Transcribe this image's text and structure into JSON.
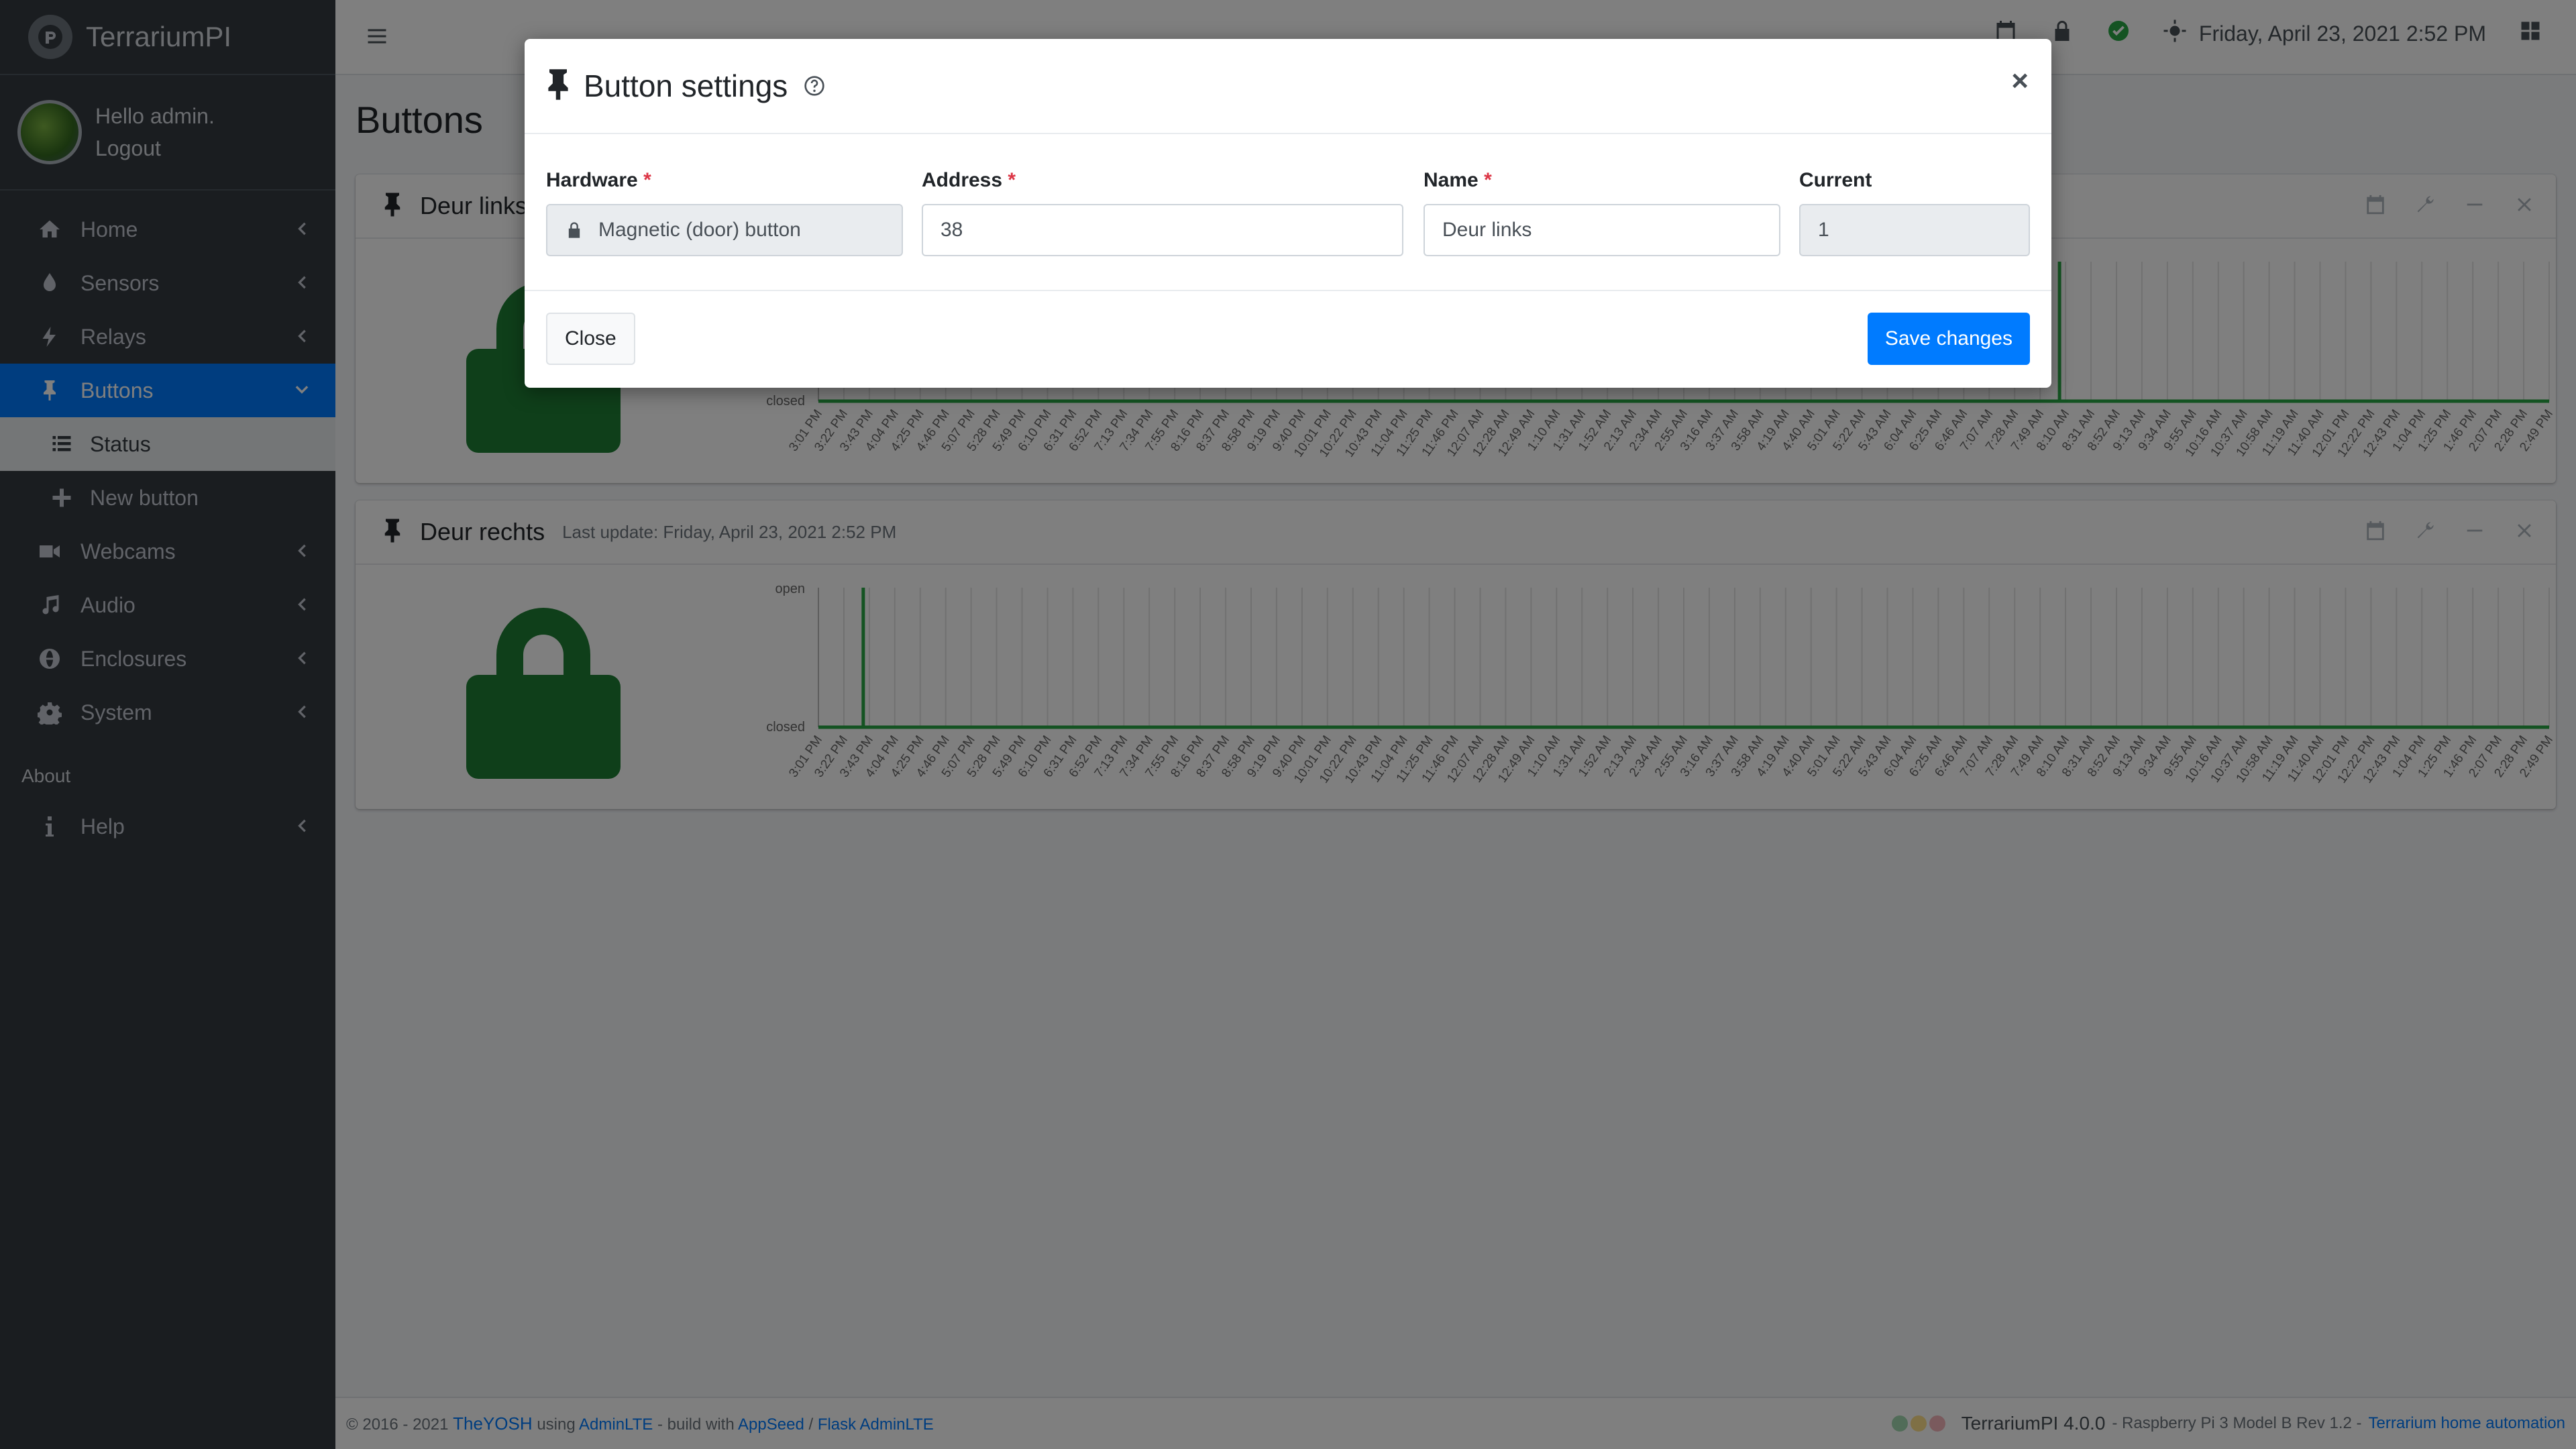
{
  "brand": {
    "name": "TerrariumPI"
  },
  "user": {
    "greeting": "Hello admin.",
    "logout": "Logout"
  },
  "sidebar": {
    "items": [
      {
        "label": "Home",
        "icon": "home-icon"
      },
      {
        "label": "Sensors",
        "icon": "tint-icon"
      },
      {
        "label": "Relays",
        "icon": "bolt-icon"
      },
      {
        "label": "Buttons",
        "icon": "thumbtack-icon"
      },
      {
        "label": "Webcams",
        "icon": "video-icon"
      },
      {
        "label": "Audio",
        "icon": "music-icon"
      },
      {
        "label": "Enclosures",
        "icon": "globe-icon"
      },
      {
        "label": "System",
        "icon": "gear-icon"
      },
      {
        "label": "Help",
        "icon": "info-icon"
      }
    ],
    "subitems": [
      {
        "label": "Status",
        "icon": "list-icon"
      },
      {
        "label": "New button",
        "icon": "plus-icon"
      }
    ],
    "about_header": "About"
  },
  "topbar": {
    "datetime": "Friday, April 23, 2021 2:52 PM"
  },
  "page": {
    "title": "Buttons"
  },
  "cards": [
    {
      "title": "Deur links",
      "subtitle": ""
    },
    {
      "title": "Deur rechts",
      "subtitle": "Last update: Friday, April 23, 2021 2:52 PM"
    }
  ],
  "chart_data": [
    {
      "type": "line",
      "title": "Deur links",
      "y_tick_labels": [
        "open",
        "closed"
      ],
      "x": [
        "3:01 PM",
        "3:22 PM",
        "3:43 PM",
        "4:04 PM",
        "4:25 PM",
        "4:46 PM",
        "5:07 PM",
        "5:28 PM",
        "5:49 PM",
        "6:10 PM",
        "6:31 PM",
        "6:52 PM",
        "7:13 PM",
        "7:34 PM",
        "7:55 PM",
        "8:16 PM",
        "8:37 PM",
        "8:58 PM",
        "9:19 PM",
        "9:40 PM",
        "10:01 PM",
        "10:22 PM",
        "10:43 PM",
        "11:04 PM",
        "11:25 PM",
        "11:46 PM",
        "12:07 AM",
        "12:28 AM",
        "12:49 AM",
        "1:10 AM",
        "1:31 AM",
        "1:52 AM",
        "2:13 AM",
        "2:34 AM",
        "2:55 AM",
        "3:16 AM",
        "3:37 AM",
        "3:58 AM",
        "4:19 AM",
        "4:40 AM",
        "5:01 AM",
        "5:22 AM",
        "5:43 AM",
        "6:04 AM",
        "6:25 AM",
        "6:46 AM",
        "7:07 AM",
        "7:28 AM",
        "7:49 AM",
        "8:10 AM",
        "8:31 AM",
        "8:52 AM",
        "9:13 AM",
        "9:34 AM",
        "9:55 AM",
        "10:16 AM",
        "10:37 AM",
        "10:58 AM",
        "11:19 AM",
        "11:40 AM",
        "12:01 PM",
        "12:22 PM",
        "12:43 PM",
        "1:04 PM",
        "1:25 PM",
        "1:46 PM",
        "2:07 PM",
        "2:28 PM",
        "2:49 PM"
      ],
      "events": [
        {
          "at": "8:05 AM",
          "state": "open"
        }
      ],
      "baseline": "closed",
      "color": "#28a745"
    },
    {
      "type": "line",
      "title": "Deur rechts",
      "y_tick_labels": [
        "open",
        "closed"
      ],
      "x": [
        "3:01 PM",
        "3:22 PM",
        "3:43 PM",
        "4:04 PM",
        "4:25 PM",
        "4:46 PM",
        "5:07 PM",
        "5:28 PM",
        "5:49 PM",
        "6:10 PM",
        "6:31 PM",
        "6:52 PM",
        "7:13 PM",
        "7:34 PM",
        "7:55 PM",
        "8:16 PM",
        "8:37 PM",
        "8:58 PM",
        "9:19 PM",
        "9:40 PM",
        "10:01 PM",
        "10:22 PM",
        "10:43 PM",
        "11:04 PM",
        "11:25 PM",
        "11:46 PM",
        "12:07 AM",
        "12:28 AM",
        "12:49 AM",
        "1:10 AM",
        "1:31 AM",
        "1:52 AM",
        "2:13 AM",
        "2:34 AM",
        "2:55 AM",
        "3:16 AM",
        "3:37 AM",
        "3:58 AM",
        "4:19 AM",
        "4:40 AM",
        "5:01 AM",
        "5:22 AM",
        "5:43 AM",
        "6:04 AM",
        "6:25 AM",
        "6:46 AM",
        "7:07 AM",
        "7:28 AM",
        "7:49 AM",
        "8:10 AM",
        "8:31 AM",
        "8:52 AM",
        "9:13 AM",
        "9:34 AM",
        "9:55 AM",
        "10:16 AM",
        "10:37 AM",
        "10:58 AM",
        "11:19 AM",
        "11:40 AM",
        "12:01 PM",
        "12:22 PM",
        "12:43 PM",
        "1:04 PM",
        "1:25 PM",
        "1:46 PM",
        "2:07 PM",
        "2:28 PM",
        "2:49 PM"
      ],
      "events": [
        {
          "at": "3:38 PM",
          "state": "open"
        }
      ],
      "baseline": "closed",
      "color": "#28a745"
    }
  ],
  "modal": {
    "title": "Button settings",
    "fields": {
      "hardware": {
        "label": "Hardware",
        "value": "Magnetic (door) button"
      },
      "address": {
        "label": "Address",
        "value": "38"
      },
      "name": {
        "label": "Name",
        "value": "Deur links"
      },
      "current": {
        "label": "Current",
        "value": "1"
      }
    },
    "close_label": "Close",
    "save_label": "Save changes"
  },
  "footer": {
    "copyright": "© 2016 - 2021",
    "author": "TheYOSH",
    "using": "using",
    "adminlte": "AdminLTE",
    "build": "- build with",
    "appseed": "AppSeed",
    "slash": "/",
    "flask": "Flask AdminLTE",
    "version": "TerrariumPI 4.0.0",
    "device": "- Raspberry Pi 3 Model B Rev 1.2 -",
    "home": "Terrarium home automation"
  }
}
